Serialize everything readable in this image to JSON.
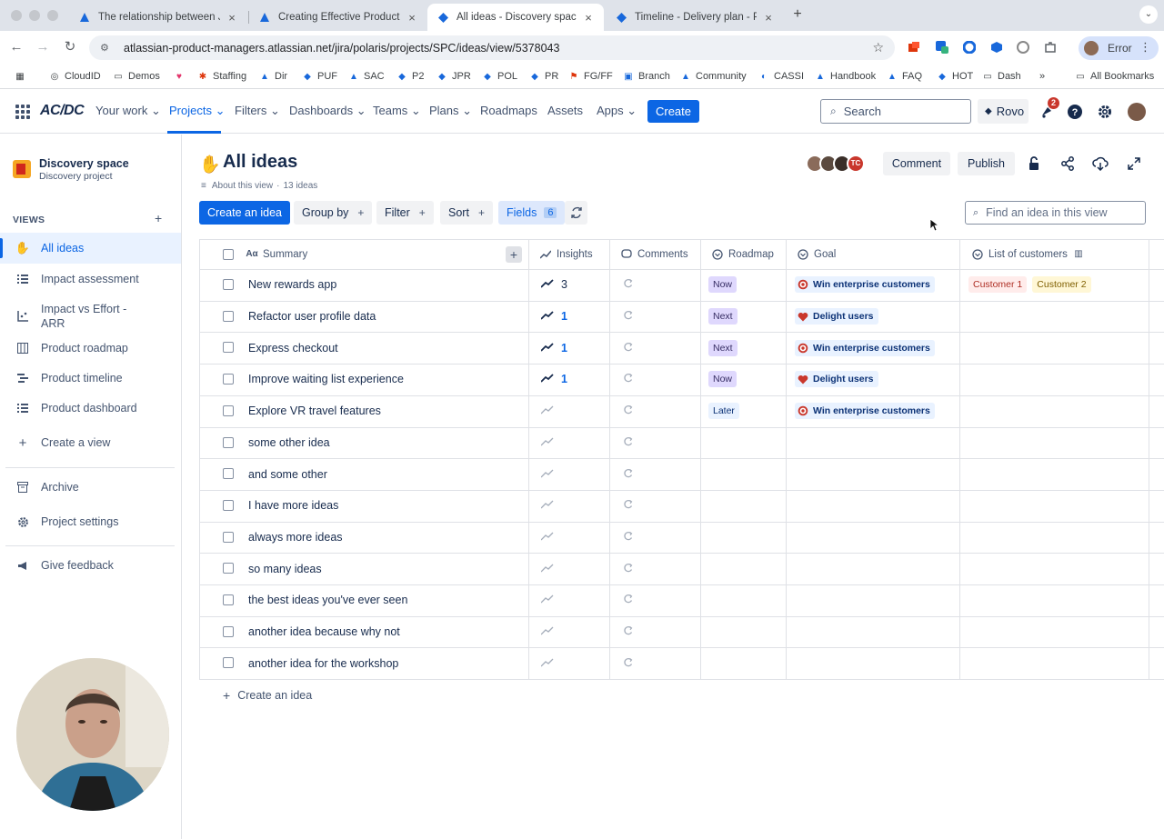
{
  "browser": {
    "tabs": [
      {
        "title": "The relationship between Jira"
      },
      {
        "title": "Creating Effective Product Ro"
      },
      {
        "title": "All ideas - Discovery space -"
      },
      {
        "title": "Timeline - Delivery plan - Pla"
      }
    ],
    "url": "atlassian-product-managers.atlassian.net/jira/polaris/projects/SPC/ideas/view/5378043",
    "profile_status": "Error",
    "bookmarks": [
      "CloudID",
      "Demos",
      "Staffing",
      "Dir",
      "PUF",
      "SAC",
      "P2",
      "JPR",
      "POL",
      "PR",
      "FG/FF",
      "Branch",
      "Community",
      "CASSI",
      "Handbook",
      "FAQ",
      "HOT",
      "Dash",
      "All Bookmarks"
    ]
  },
  "topnav": {
    "logo": "AC/DC",
    "items": [
      "Your work",
      "Projects",
      "Filters",
      "Dashboards",
      "Teams",
      "Plans",
      "Roadmaps",
      "Assets",
      "Apps"
    ],
    "create": "Create",
    "search_placeholder": "Search",
    "rovo": "Rovo",
    "notification_count": "2"
  },
  "sidebar": {
    "project_name": "Discovery space",
    "project_type": "Discovery project",
    "views_label": "VIEWS",
    "views_add": "+",
    "items": [
      {
        "label": "All ideas"
      },
      {
        "label": "Impact assessment"
      },
      {
        "label": "Impact vs Effort - ARR"
      },
      {
        "label": "Product roadmap"
      },
      {
        "label": "Product timeline"
      },
      {
        "label": "Product dashboard"
      },
      {
        "label": "Create a view"
      },
      {
        "label": "Archive"
      },
      {
        "label": "Project settings"
      },
      {
        "label": "Give feedback"
      }
    ]
  },
  "main": {
    "title": "All ideas",
    "about": "About this view",
    "idea_count": "13 ideas",
    "avatar_initials": "TC",
    "comment": "Comment",
    "publish": "Publish",
    "create_idea": "Create an idea",
    "group_by": "Group by",
    "filter": "Filter",
    "sort": "Sort",
    "fields": "Fields",
    "fields_count": "6",
    "find_placeholder": "Find an idea in this view",
    "add_row_label": "Create an idea"
  },
  "table": {
    "columns": [
      "Summary",
      "Insights",
      "Comments",
      "Roadmap",
      "Goal",
      "List of customers"
    ],
    "rows": [
      {
        "summary": "New rewards app",
        "insights": "3",
        "roadmap": "Now",
        "goal": "Win enterprise customers",
        "customers": [
          "Customer 1",
          "Customer 2"
        ]
      },
      {
        "summary": "Refactor user profile data",
        "insights": "1",
        "roadmap": "Next",
        "goal": "Delight users",
        "customers": []
      },
      {
        "summary": "Express checkout",
        "insights": "1",
        "roadmap": "Next",
        "goal": "Win enterprise customers",
        "customers": []
      },
      {
        "summary": "Improve waiting list experience",
        "insights": "1",
        "roadmap": "Now",
        "goal": "Delight users",
        "customers": []
      },
      {
        "summary": "Explore VR travel features",
        "insights": "",
        "roadmap": "Later",
        "goal": "Win enterprise customers",
        "customers": []
      },
      {
        "summary": "some other idea",
        "insights": "",
        "roadmap": "",
        "goal": "",
        "customers": []
      },
      {
        "summary": "and some other",
        "insights": "",
        "roadmap": "",
        "goal": "",
        "customers": []
      },
      {
        "summary": "I have more ideas",
        "insights": "",
        "roadmap": "",
        "goal": "",
        "customers": []
      },
      {
        "summary": "always more ideas",
        "insights": "",
        "roadmap": "",
        "goal": "",
        "customers": []
      },
      {
        "summary": "so many ideas",
        "insights": "",
        "roadmap": "",
        "goal": "",
        "customers": []
      },
      {
        "summary": "the best ideas you've ever seen",
        "insights": "",
        "roadmap": "",
        "goal": "",
        "customers": []
      },
      {
        "summary": "another idea because why not",
        "insights": "",
        "roadmap": "",
        "goal": "",
        "customers": []
      },
      {
        "summary": "another idea for the workshop",
        "insights": "",
        "roadmap": "",
        "goal": "",
        "customers": []
      }
    ]
  },
  "colors": {
    "brand_blue": "#0c66e4",
    "roadmap_now_bg": "#dfd8fd",
    "roadmap_next_bg": "#dfd8fd",
    "roadmap_later_bg": "#e9f2ff",
    "customer_1_bg": "#ffeceb",
    "customer_2_bg": "#fff7d6"
  }
}
